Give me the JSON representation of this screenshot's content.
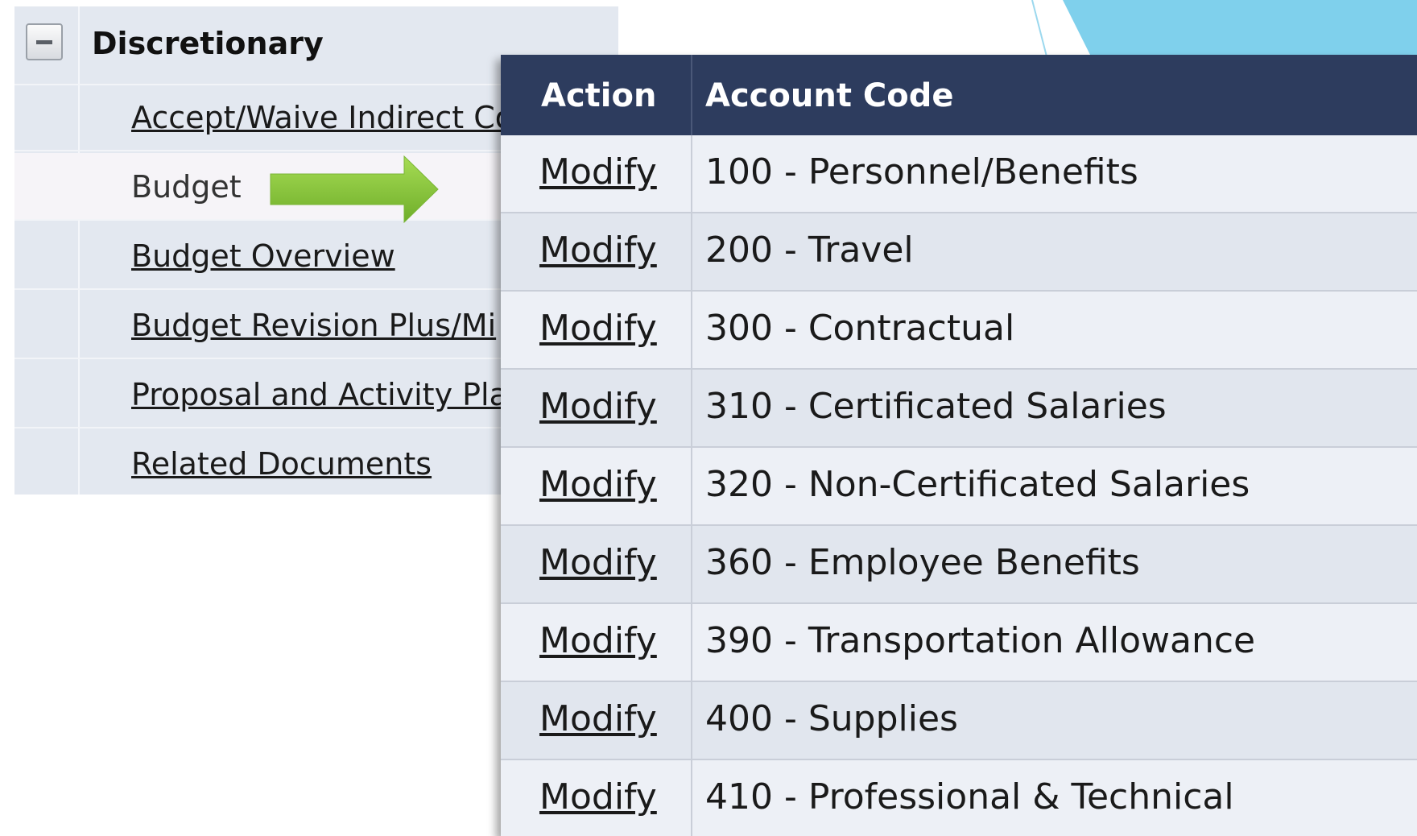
{
  "nav": {
    "section_title": "Discretionary",
    "items": [
      {
        "label": "Accept/Waive Indirect Co",
        "selected": false
      },
      {
        "label": "Budget",
        "selected": true
      },
      {
        "label": "Budget Overview",
        "selected": false
      },
      {
        "label": "Budget Revision Plus/Mi",
        "selected": false
      },
      {
        "label": "Proposal and Activity Pla",
        "selected": false
      },
      {
        "label": "Related Documents",
        "selected": false
      }
    ]
  },
  "table": {
    "headers": {
      "action": "Action",
      "account_code": "Account Code"
    },
    "rows": [
      {
        "action": "Modify",
        "account_code": "100 - Personnel/Benefits"
      },
      {
        "action": "Modify",
        "account_code": "200 - Travel"
      },
      {
        "action": "Modify",
        "account_code": "300 - Contractual"
      },
      {
        "action": "Modify",
        "account_code": "310 - Certificated Salaries"
      },
      {
        "action": "Modify",
        "account_code": "320 - Non-Certificated Salaries"
      },
      {
        "action": "Modify",
        "account_code": "360 - Employee Benefits"
      },
      {
        "action": "Modify",
        "account_code": "390 - Transportation Allowance"
      },
      {
        "action": "Modify",
        "account_code": "400 - Supplies"
      },
      {
        "action": "Modify",
        "account_code": "410 - Professional & Technical"
      }
    ]
  },
  "colors": {
    "header_bg": "#2d3c5e",
    "arrow": "#8cc63f",
    "deco": "#7fd0ec"
  },
  "icons": {
    "collapse": "minus-square-icon",
    "pointer": "right-arrow-icon"
  }
}
